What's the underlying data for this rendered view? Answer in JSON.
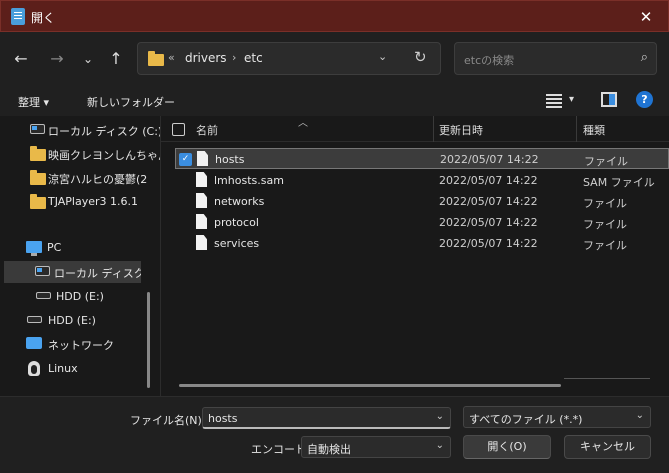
{
  "window": {
    "title": "開く"
  },
  "nav": {
    "breadcrumb_overflow": "«",
    "path": [
      "drivers",
      "etc"
    ],
    "search_placeholder": "etcの検索"
  },
  "toolbar": {
    "organize_label": "整理",
    "new_folder_label": "新しいフォルダー"
  },
  "sidebar": {
    "items": [
      {
        "label": "ローカル ディスク (C:)",
        "icon": "drive-icon"
      },
      {
        "label": "映画クレヨンしんちゃん",
        "icon": "folder-icon"
      },
      {
        "label": "涼宮ハルヒの憂鬱(2",
        "icon": "folder-icon"
      },
      {
        "label": "TJAPlayer3 1.6.1",
        "icon": "folder-icon"
      },
      {
        "label": "PC",
        "icon": "pc-icon"
      },
      {
        "label": "ローカル ディスク (C:)",
        "icon": "drive-icon"
      },
      {
        "label": "HDD (E:)",
        "icon": "drive-icon"
      },
      {
        "label": "HDD (E:)",
        "icon": "drive-icon"
      },
      {
        "label": "ネットワーク",
        "icon": "network-icon"
      },
      {
        "label": "Linux",
        "icon": "linux-icon"
      }
    ]
  },
  "columns": {
    "name": "名前",
    "date": "更新日時",
    "type": "種類"
  },
  "files": [
    {
      "name": "hosts",
      "date": "2022/05/07 14:22",
      "type": "ファイル",
      "selected": true
    },
    {
      "name": "lmhosts.sam",
      "date": "2022/05/07 14:22",
      "type": "SAM ファイル",
      "selected": false
    },
    {
      "name": "networks",
      "date": "2022/05/07 14:22",
      "type": "ファイル",
      "selected": false
    },
    {
      "name": "protocol",
      "date": "2022/05/07 14:22",
      "type": "ファイル",
      "selected": false
    },
    {
      "name": "services",
      "date": "2022/05/07 14:22",
      "type": "ファイル",
      "selected": false
    }
  ],
  "bottom": {
    "filename_label": "ファイル名(N):",
    "filename_value": "hosts",
    "filter_value": "すべてのファイル (*.*)",
    "encoding_label": "エンコード:",
    "encoding_value": "自動検出",
    "open_label": "開く(O)",
    "cancel_label": "キャンセル"
  },
  "colors": {
    "titlebar": "#5c1f1a",
    "accent": "#3b8ee0",
    "folder": "#e9b949"
  }
}
